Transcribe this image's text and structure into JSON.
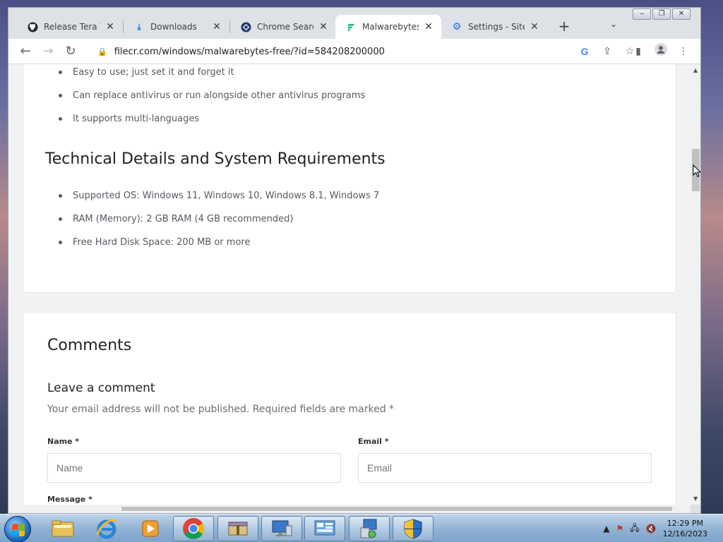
{
  "window_controls": [
    "‒",
    "❐",
    "✕"
  ],
  "tabs": [
    {
      "title": "Release Tera Ter",
      "icon": "github-icon",
      "active": false
    },
    {
      "title": "Downloads",
      "icon": "download-icon",
      "active": false
    },
    {
      "title": "Chrome Search",
      "icon": "chrome-search-icon",
      "active": false
    },
    {
      "title": "Malwarebytes D",
      "icon": "filecr-icon",
      "active": true
    },
    {
      "title": "Settings - Site s",
      "icon": "gear-icon",
      "active": false
    }
  ],
  "toolbar": {
    "url": "filecr.com/windows/malwarebytes-free/?id=584208200000"
  },
  "page": {
    "features": [
      "Easy to use; just set it and forget it",
      "Can replace antivirus or run alongside other antivirus programs",
      "It supports multi-languages"
    ],
    "tech_heading": "Technical Details and System Requirements",
    "requirements": [
      "Supported OS: Windows 11, Windows 10, Windows 8.1, Windows 7",
      "RAM (Memory): 2 GB RAM (4 GB recommended)",
      "Free Hard Disk Space: 200 MB or more"
    ],
    "comments_heading": "Comments",
    "leave_heading": "Leave a comment",
    "note": "Your email address will not be published. Required fields are marked *",
    "name_label": "Name *",
    "name_placeholder": "Name",
    "email_label": "Email *",
    "email_placeholder": "Email",
    "message_label": "Message *"
  },
  "taskbar": {
    "time": "12:29 PM",
    "date": "12/16/2023"
  }
}
